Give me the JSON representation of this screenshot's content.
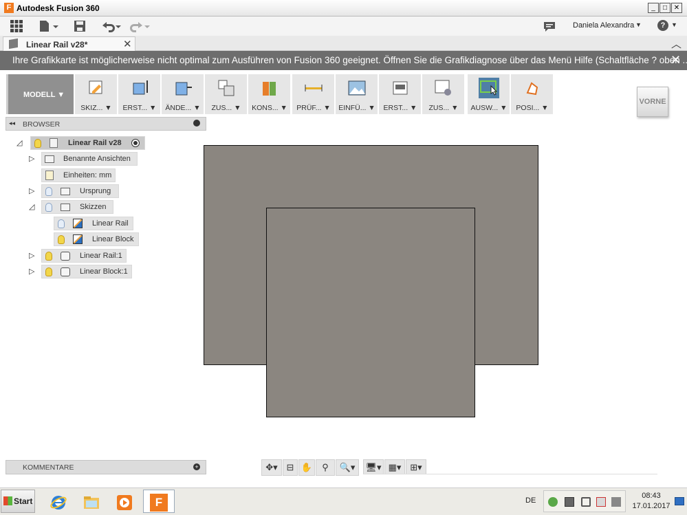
{
  "window": {
    "title": "Autodesk Fusion 360",
    "logo_letter": "F",
    "min_glyph": "_",
    "max_glyph": "□",
    "close_glyph": "✕"
  },
  "qat": {
    "user": "Daniela Alexandra",
    "user_caret": "▼",
    "help_glyph": "?",
    "help_caret": "▼"
  },
  "doctab": {
    "label": "Linear Rail v28*",
    "close_glyph": "✕",
    "collapse_glyph": "︿"
  },
  "warning": {
    "text": "Ihre Grafikkarte ist möglicherweise nicht optimal zum Ausführen von Fusion 360 geeignet. Öffnen Sie die Grafikdiagnose über das Menü Hilfe (Schaltfläche ? oben ...",
    "close_glyph": "✕"
  },
  "toolbar": {
    "workspace": "MODELL ▼",
    "groups": [
      {
        "label": "SKIZ... ▼",
        "icon": "sketch-icon"
      },
      {
        "label": "ERST... ▼",
        "icon": "create-icon"
      },
      {
        "label": "ÄNDE... ▼",
        "icon": "modify-icon"
      },
      {
        "label": "ZUS... ▼",
        "icon": "assemble-icon"
      },
      {
        "label": "KONS... ▼",
        "icon": "construct-icon"
      },
      {
        "label": "PRÜF... ▼",
        "icon": "inspect-icon"
      },
      {
        "label": "EINFÜ... ▼",
        "icon": "insert-icon"
      },
      {
        "label": "ERST... ▼",
        "icon": "make-icon"
      },
      {
        "label": "ZUS... ▼",
        "icon": "addins-icon"
      },
      {
        "label": "AUSW... ▼",
        "icon": "select-icon"
      },
      {
        "label": "POSI... ▼",
        "icon": "position-icon"
      }
    ]
  },
  "viewcube": {
    "label": "VORNE"
  },
  "browser": {
    "header": "BROWSER",
    "collapse_glyph": "◂◂",
    "root": {
      "label": "Linear Rail v28"
    },
    "items": [
      {
        "label": "Benannte Ansichten"
      },
      {
        "label": "Einheiten: mm"
      },
      {
        "label": "Ursprung"
      },
      {
        "label": "Skizzen"
      },
      {
        "label": "Linear Rail"
      },
      {
        "label": "Linear Block"
      },
      {
        "label": "Linear Rail:1"
      },
      {
        "label": "Linear Block:1"
      }
    ],
    "expand_glyph": "▷",
    "expanded_glyph": "◿"
  },
  "comments": {
    "header": "KOMMENTARE",
    "add_glyph": "+"
  },
  "navbar": {
    "orbit": "✥▾",
    "lookat": "⊟",
    "pan": "✋",
    "zoomwin": "⚲",
    "zoom": "🔍▾",
    "display": "🖥▾",
    "grid": "▦▾",
    "viewports": "⊞▾"
  },
  "taskbar": {
    "start": "Start",
    "lang": "DE",
    "time": "08:43",
    "date": "17.01.2017",
    "fusion_badge": "F"
  },
  "colors": {
    "body_fill": "#8b8680",
    "warning_bg": "#6d6d6d",
    "accent_orange": "#f07a1f"
  }
}
